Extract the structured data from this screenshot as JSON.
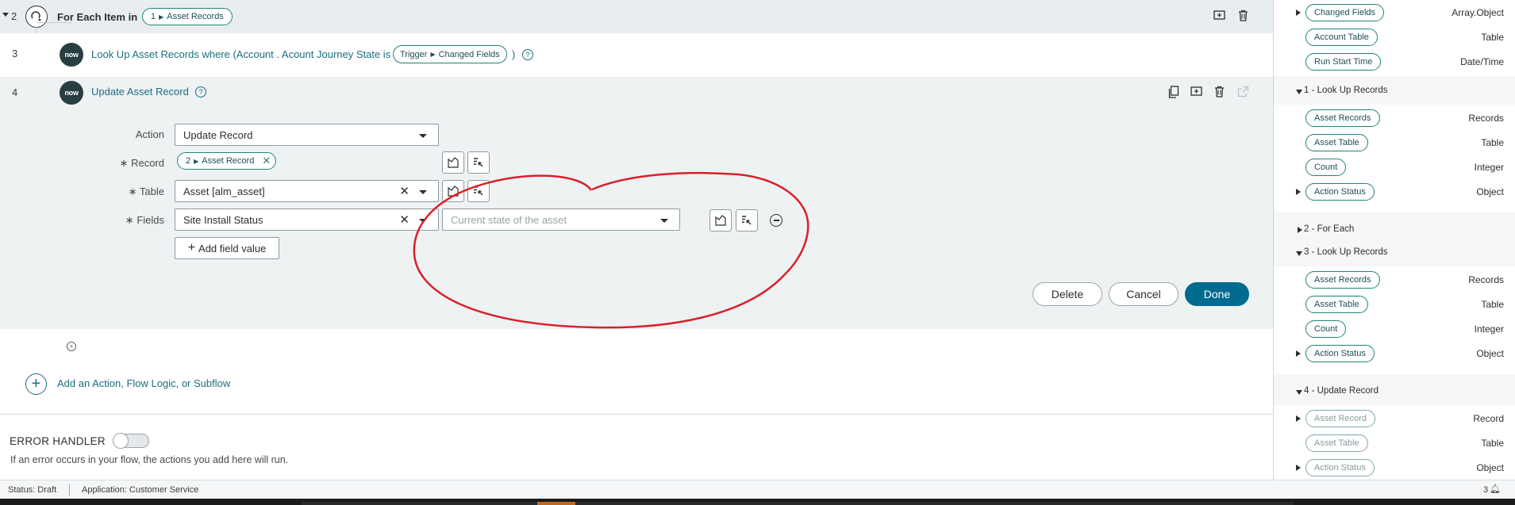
{
  "flow": {
    "step2": {
      "number": "2",
      "title": "For Each Item in",
      "pill_num": "1",
      "pill_label": "Asset Records"
    },
    "step3": {
      "number": "3",
      "logo": "now",
      "text": "Look Up Asset Records where (Account . Acount Journey State is",
      "pill_a": "Trigger",
      "pill_b": "Changed Fields",
      "close": ")",
      "help": "?"
    },
    "step4": {
      "number": "4",
      "logo": "now",
      "title": "Update Asset Record",
      "help": "?",
      "action_label": "Action",
      "action_value": "Update Record",
      "record_label": "Record",
      "record_pill_num": "2",
      "record_pill_label": "Asset Record",
      "table_label": "Table",
      "table_value": "Asset [alm_asset]",
      "fields_label": "Fields",
      "fields_value": "Site Install Status",
      "value_placeholder": "Current state of the asset",
      "required_mark": "∗",
      "add_field_label": "Add field value",
      "delete_label": "Delete",
      "cancel_label": "Cancel",
      "done_label": "Done"
    },
    "add_action_label": "Add an Action, Flow Logic, or Subflow",
    "error_handler": {
      "title": "ERROR HANDLER",
      "desc": "If an error occurs in your flow, the actions you add here will run."
    }
  },
  "data_panel": {
    "trigger_items": [
      {
        "label": "Changed Fields",
        "type": "Array.Object",
        "expandable": true
      },
      {
        "label": "Account Table",
        "type": "Table",
        "expandable": false
      },
      {
        "label": "Run Start Time",
        "type": "Date/Time",
        "expandable": false
      }
    ],
    "sections": [
      {
        "title": "1 - Look Up Records",
        "expanded": true,
        "items": [
          {
            "label": "Asset Records",
            "type": "Records",
            "expandable": false
          },
          {
            "label": "Asset Table",
            "type": "Table",
            "expandable": false
          },
          {
            "label": "Count",
            "type": "Integer",
            "expandable": false
          },
          {
            "label": "Action Status",
            "type": "Object",
            "expandable": true
          }
        ]
      },
      {
        "title": "2 - For Each",
        "expanded": false,
        "items": []
      },
      {
        "title": "3 - Look Up Records",
        "expanded": true,
        "items": [
          {
            "label": "Asset Records",
            "type": "Records",
            "expandable": false
          },
          {
            "label": "Asset Table",
            "type": "Table",
            "expandable": false
          },
          {
            "label": "Count",
            "type": "Integer",
            "expandable": false
          },
          {
            "label": "Action Status",
            "type": "Object",
            "expandable": true
          }
        ]
      },
      {
        "title": "4 - Update Record",
        "expanded": true,
        "items": [
          {
            "label": "Asset Record",
            "type": "Record",
            "expandable": true
          },
          {
            "label": "Asset Table",
            "type": "Table",
            "expandable": false
          },
          {
            "label": "Action Status",
            "type": "Object",
            "expandable": true
          }
        ]
      }
    ]
  },
  "status_bar": {
    "status": "Status: Draft",
    "application": "Application: Customer Service",
    "count": "3"
  },
  "colors": {
    "accent": "#006b8f",
    "pill_border": "#1f8476",
    "annotation": "#d9202a",
    "now_logo": "#293e40"
  },
  "icons": [
    "loop-icon",
    "add-comment-icon",
    "trash-icon",
    "copy-icon",
    "external-link-icon",
    "data-pill-picker-icon",
    "script-icon",
    "remove-circle-icon",
    "plus-icon",
    "bell-icon"
  ]
}
